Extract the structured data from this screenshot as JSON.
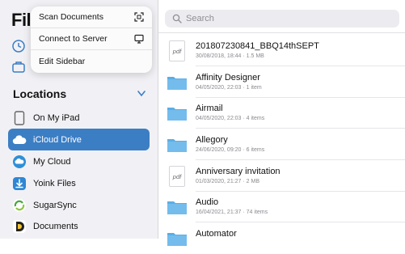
{
  "app": {
    "title": "Files"
  },
  "menu": {
    "items": [
      {
        "label": "Scan Documents",
        "icon": "scan-icon"
      },
      {
        "label": "Connect to Server",
        "icon": "monitor-icon"
      },
      {
        "label": "Edit Sidebar"
      }
    ]
  },
  "sidebar": {
    "locations_title": "Locations",
    "locations": [
      {
        "label": "On My iPad",
        "icon": "ipad-icon"
      },
      {
        "label": "iCloud Drive",
        "icon": "icloud-icon",
        "selected": true
      },
      {
        "label": "My Cloud",
        "icon": "mycloud-icon"
      },
      {
        "label": "Yoink Files",
        "icon": "yoink-icon"
      },
      {
        "label": "SugarSync",
        "icon": "sugarsync-icon"
      },
      {
        "label": "Documents",
        "icon": "documents-app-icon"
      }
    ]
  },
  "search": {
    "placeholder": "Search"
  },
  "files": [
    {
      "name": "201807230841_BBQ14thSEPT",
      "meta": "30/08/2018, 18:44 · 1.5 MB",
      "type": "pdf"
    },
    {
      "name": "Affinity Designer",
      "meta": "04/05/2020, 22:03 · 1 item",
      "type": "folder"
    },
    {
      "name": "Airmail",
      "meta": "04/05/2020, 22:03 · 4 items",
      "type": "folder"
    },
    {
      "name": "Allegory",
      "meta": "24/06/2020, 09:20 · 6 items",
      "type": "folder"
    },
    {
      "name": "Anniversary invitation",
      "meta": "01/03/2020, 21:27 · 2 MB",
      "type": "pdf"
    },
    {
      "name": "Audio",
      "meta": "16/04/2021, 21:37 · 74 items",
      "type": "folder"
    },
    {
      "name": "Automator",
      "meta": "",
      "type": "folder"
    }
  ],
  "colors": {
    "accent": "#3c7ec4",
    "folder": "#5aaee6",
    "sidebar_bg": "#f1f1f5"
  }
}
